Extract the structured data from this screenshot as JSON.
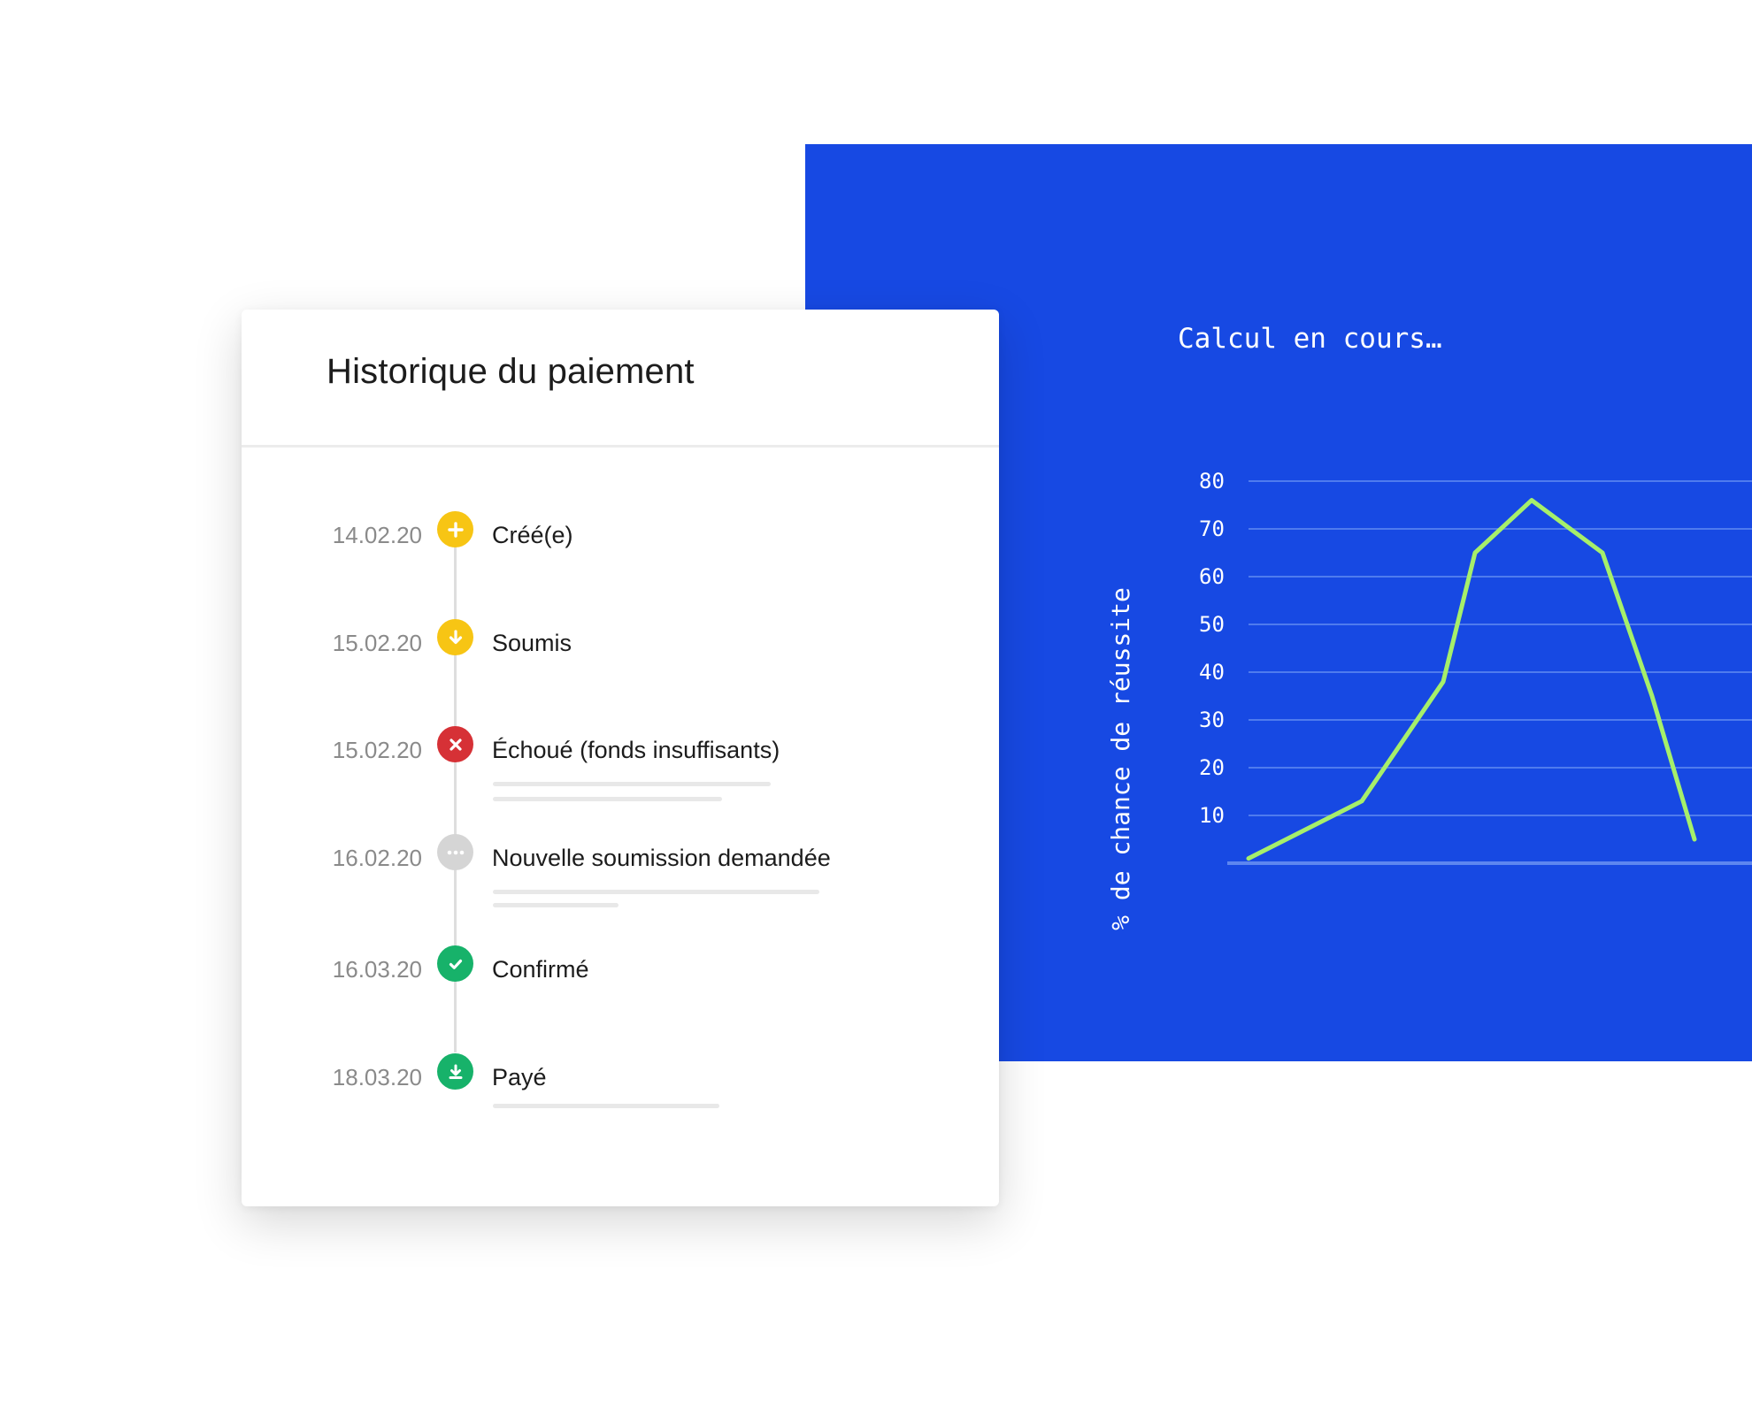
{
  "chart_panel": {
    "title": "Calcul en cours…",
    "ylabel": "% de chance de réussite",
    "bg_color": "#1749e3",
    "line_color": "#a6ef6a"
  },
  "chart_data": {
    "type": "line",
    "title": "Calcul en cours…",
    "xlabel": "",
    "ylabel": "% de chance de réussite",
    "yticks": [
      10,
      20,
      30,
      40,
      50,
      60,
      70,
      80
    ],
    "ylim": [
      0,
      80
    ],
    "grid": true,
    "series": [
      {
        "x": [
          0,
          1.6,
          2.75,
          3.2,
          4.0,
          5.0,
          5.7,
          6.3
        ],
        "values": [
          1,
          13,
          38,
          65,
          76,
          65,
          35,
          5
        ]
      }
    ]
  },
  "payment_history": {
    "title": "Historique du paiement",
    "events": [
      {
        "date": "14.02.20",
        "label": "Créé(e)",
        "icon": "plus-icon",
        "color": "#f7c514"
      },
      {
        "date": "15.02.20",
        "label": "Soumis",
        "icon": "arrow-down-icon",
        "color": "#f7c514"
      },
      {
        "date": "15.02.20",
        "label": "Échoué (fonds insuffisants)",
        "icon": "cross-icon",
        "color": "#d63136"
      },
      {
        "date": "16.02.20",
        "label": "Nouvelle soumission demandée",
        "icon": "more-dots-icon",
        "color": "#d5d5d5"
      },
      {
        "date": "16.03.20",
        "label": "Confirmé",
        "icon": "check-icon",
        "color": "#17b26a"
      },
      {
        "date": "18.03.20",
        "label": "Payé",
        "icon": "download-icon",
        "color": "#17b26a"
      }
    ]
  }
}
